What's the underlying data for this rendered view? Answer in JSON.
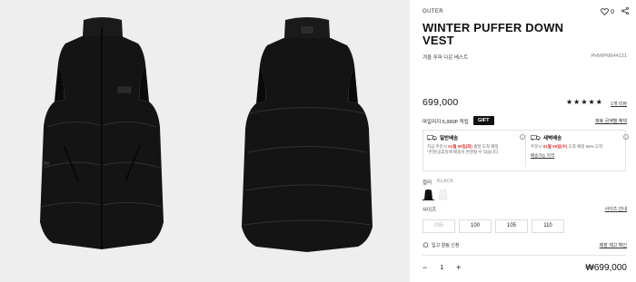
{
  "product": {
    "category": "OUTER",
    "title": "WINTER PUFFER DOWN VEST",
    "subtitle": "겨울 푸퍼 다운 베스트",
    "code": "PHWPM644121",
    "price": "699,000",
    "rating_stars": "★★★★★",
    "review_link": "1개 리뷰",
    "wishlist_count": "0"
  },
  "benefits": {
    "mileage": "마일리지 6,990P 적립",
    "gift_badge": "GIFT",
    "link": "제휴 금액별 혜택"
  },
  "delivery": {
    "standard": {
      "title": "일반배송",
      "line1_prefix": "지금 주문시",
      "line1_date": "01월 09일(화)",
      "line1_suffix": "출발 도착 예정",
      "line2": "*주말/공휴일에 배송이 변경될 수 있습니다"
    },
    "dawn": {
      "title": "새벽배송",
      "line1_prefix": "주문시",
      "line1_date": "01월 09일(수)",
      "line1_suffix": "도착 예정 98% 도착",
      "link": "배송가능 지역"
    }
  },
  "color": {
    "label": "컬러",
    "selected": "BLACK"
  },
  "size": {
    "label": "사이즈",
    "guide": "사이즈 안내",
    "options": [
      "095",
      "100",
      "105",
      "110"
    ],
    "sold_out": [
      true,
      false,
      false,
      false
    ]
  },
  "restock": {
    "label": "입고 알림 신청",
    "store_link": "매장 재고 확인"
  },
  "order": {
    "minus": "−",
    "quantity": "1",
    "plus": "+",
    "total": "₩699,000"
  },
  "colors": {
    "background_gallery": "#eeeeee",
    "accent_red": "#dd3333",
    "vest": "#151515"
  }
}
